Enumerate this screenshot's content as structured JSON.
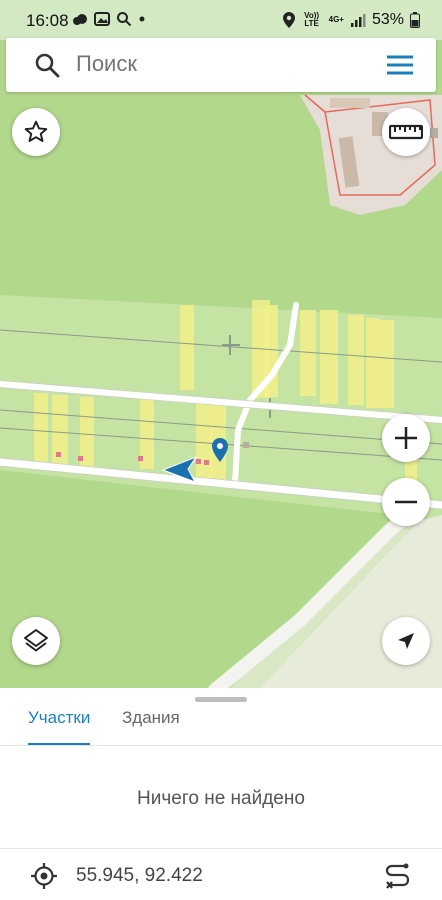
{
  "status_bar": {
    "time": "16:08",
    "network_top": "Vo)) LTE",
    "network_label": "4G+",
    "battery": "53%"
  },
  "search": {
    "placeholder": "Поиск"
  },
  "tabs": [
    {
      "label": "Участки",
      "active": true
    },
    {
      "label": "Здания",
      "active": false
    }
  ],
  "results": {
    "empty_message": "Ничего не найдено"
  },
  "coordinates": {
    "value": "55.945, 92.422"
  },
  "icons": {
    "search": "search-icon",
    "menu": "menu-icon",
    "favorite": "star-icon",
    "ruler": "ruler-icon",
    "zoom_in": "plus-icon",
    "zoom_out": "minus-icon",
    "layers": "layers-icon",
    "location": "navigation-arrow-icon",
    "target": "crosshair-icon",
    "route": "route-icon"
  },
  "colors": {
    "accent": "#1b7fbd",
    "map_green": "#b3d98e",
    "parcel_yellow": "#f2f08a",
    "building_outline": "#e46a5a"
  }
}
